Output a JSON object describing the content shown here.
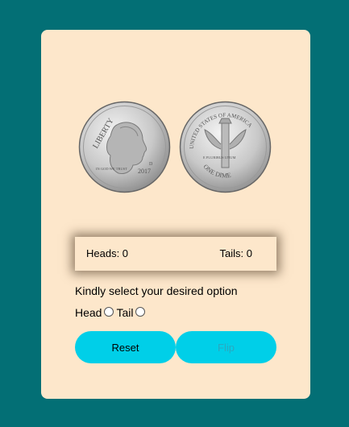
{
  "coins": {
    "heads_icon": "dime-heads-icon",
    "tails_icon": "dime-tails-icon",
    "heads_text": {
      "liberty": "LIBERTY",
      "motto": "IN GOD WE TRUST",
      "year": "2017",
      "mint": "D"
    },
    "tails_text": {
      "top": "UNITED STATES OF AMERICA",
      "motto": "E PLURIBUS UNUM",
      "value": "ONE DIME"
    }
  },
  "score": {
    "heads_label": "Heads: 0",
    "tails_label": "Tails: 0"
  },
  "prompt": "Kindly select your desired option",
  "options": {
    "head_label": "Head",
    "tail_label": "Tail"
  },
  "buttons": {
    "reset_label": "Reset",
    "flip_label": "Flip"
  },
  "colors": {
    "background": "#036f75",
    "card": "#fde7cb",
    "button": "#00cfe8"
  }
}
